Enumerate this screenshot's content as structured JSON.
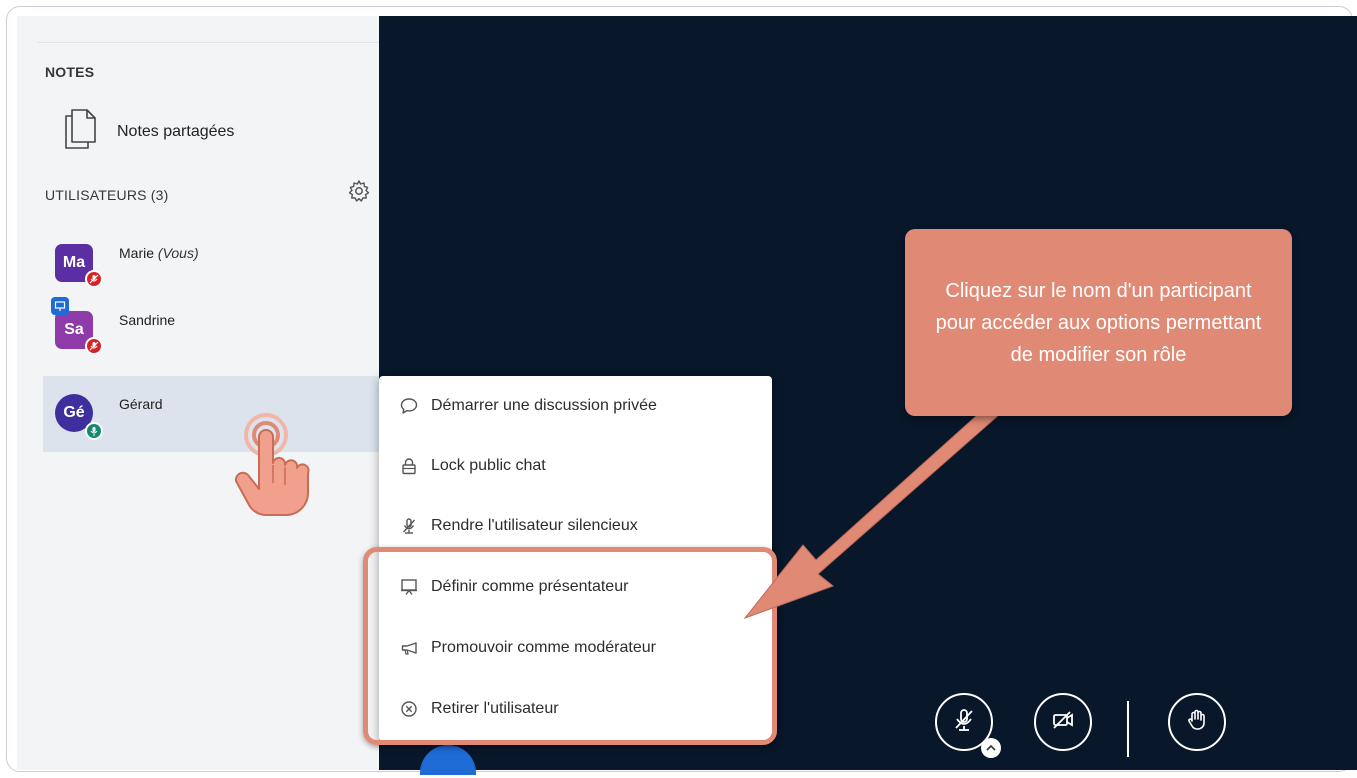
{
  "sidebar": {
    "notes_section_label": "NOTES",
    "shared_notes_label": "Notes partagées",
    "users_section_label": "UTILISATEURS (3)",
    "users": [
      {
        "initials": "Ma",
        "name": "Marie",
        "suffix": "(Vous)",
        "avatar_color": "#5b2fa3",
        "mic_status": "muted",
        "badge_color": "#d62424"
      },
      {
        "initials": "Sa",
        "name": "Sandrine",
        "suffix": "",
        "avatar_color": "#8e3aa8",
        "mic_status": "muted",
        "badge_color": "#d62424",
        "presenter": true
      },
      {
        "initials": "Gé",
        "name": "Gérard",
        "suffix": "",
        "avatar_color": "#3f2f9e",
        "mic_status": "active",
        "badge_color": "#138a6c",
        "selected": true
      }
    ]
  },
  "context_menu": {
    "items": [
      {
        "label": "Démarrer une discussion privée",
        "icon": "chat-bubble-icon"
      },
      {
        "label": "Lock public chat",
        "icon": "lock-icon"
      },
      {
        "label": "Rendre l'utilisateur silencieux",
        "icon": "mic-muted-icon"
      },
      {
        "label": "Définir comme présentateur",
        "icon": "presentation-icon"
      },
      {
        "label": "Promouvoir comme modérateur",
        "icon": "megaphone-icon"
      },
      {
        "label": "Retirer l'utilisateur",
        "icon": "close-circle-icon"
      }
    ]
  },
  "callout": {
    "text": "Cliquez sur le nom d'un participant pour accéder aux options permettant de modifier son rôle"
  },
  "controls": {
    "icons": [
      "mic-muted-icon",
      "camera-off-icon",
      "raise-hand-icon"
    ]
  },
  "colors": {
    "stage_background": "#09172b",
    "annotation": "#e08a75",
    "sidebar_background": "#f3f4f6"
  }
}
